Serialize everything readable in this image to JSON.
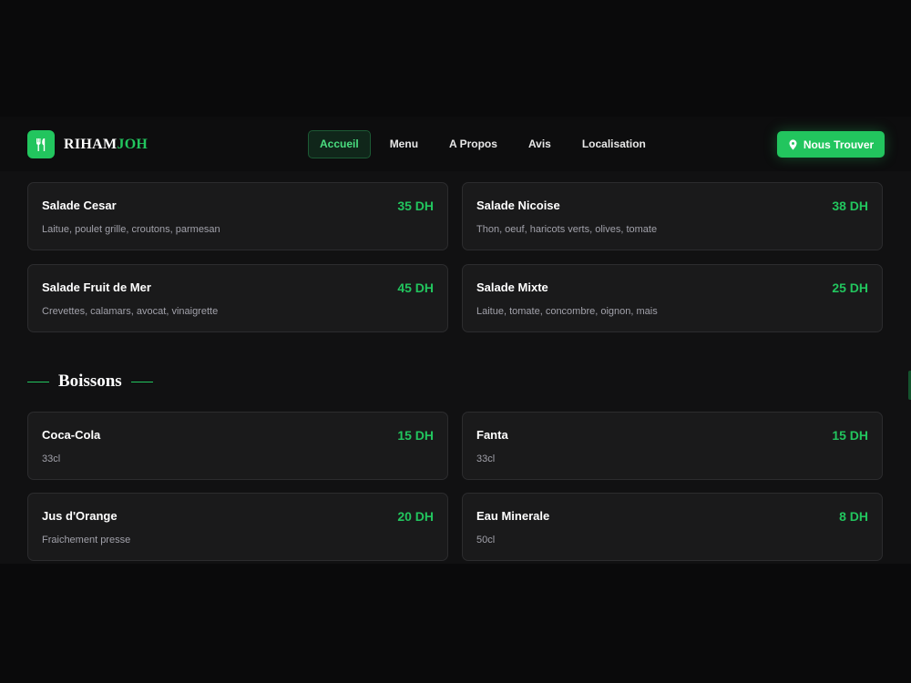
{
  "brand": {
    "name_part1": "RIHAM",
    "name_part2": "JOH",
    "icon": "utensils-icon"
  },
  "nav": {
    "items": [
      "Accueil",
      "Menu",
      "A Propos",
      "Avis",
      "Localisation"
    ],
    "active": "Accueil"
  },
  "cta": {
    "label": "Nous Trouver",
    "icon": "map-pin-icon"
  },
  "colors": {
    "accent": "#22c55e",
    "background": "#0a0a0b",
    "card": "#1a1a1b"
  },
  "salades": [
    {
      "name": "Salade Cesar",
      "price": "35 DH",
      "desc": "Laitue, poulet grille, croutons, parmesan"
    },
    {
      "name": "Salade Nicoise",
      "price": "38 DH",
      "desc": "Thon, oeuf, haricots verts, olives, tomate"
    },
    {
      "name": "Salade Fruit de Mer",
      "price": "45 DH",
      "desc": "Crevettes, calamars, avocat, vinaigrette"
    },
    {
      "name": "Salade Mixte",
      "price": "25 DH",
      "desc": "Laitue, tomate, concombre, oignon, mais"
    }
  ],
  "boissons": {
    "title": "Boissons",
    "items": [
      {
        "name": "Coca-Cola",
        "price": "15 DH",
        "desc": "33cl"
      },
      {
        "name": "Fanta",
        "price": "15 DH",
        "desc": "33cl"
      },
      {
        "name": "Jus d'Orange",
        "price": "20 DH",
        "desc": "Fraichement presse"
      },
      {
        "name": "Eau Minerale",
        "price": "8 DH",
        "desc": "50cl"
      }
    ]
  }
}
